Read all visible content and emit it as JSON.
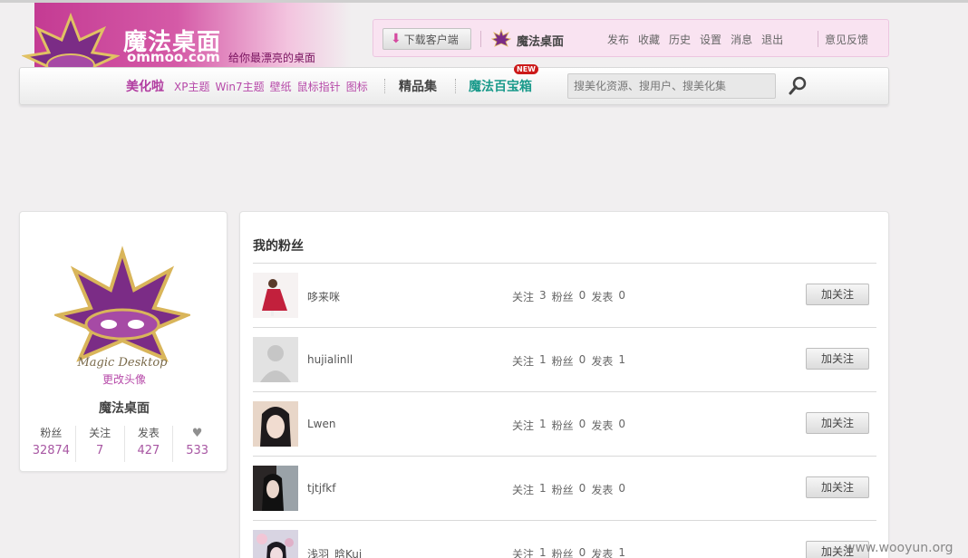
{
  "header": {
    "site_name": "魔法桌面",
    "site_domain": "ommoo.com",
    "slogan": "给你最漂亮的桌面",
    "download_label": "下载客户端",
    "app_name": "魔法桌面",
    "top_links": [
      "发布",
      "收藏",
      "历史",
      "设置",
      "消息",
      "退出"
    ],
    "feedback": "意见反馈"
  },
  "nav": {
    "main": "美化啦",
    "links": [
      "XP主题",
      "Win7主题",
      "壁纸",
      "鼠标指针",
      "图标"
    ],
    "featured": "精品集",
    "treasure": "魔法百宝箱",
    "new_badge": "NEW",
    "search_placeholder": "搜美化资源、搜用户、搜美化集"
  },
  "profile": {
    "change_avatar": "更改头像",
    "name": "魔法桌面",
    "stats": [
      {
        "label": "粉丝",
        "value": "32874"
      },
      {
        "label": "关注",
        "value": "7"
      },
      {
        "label": "发表",
        "value": "427"
      },
      {
        "label": "",
        "icon": "heart-icon",
        "value": "533"
      }
    ]
  },
  "fans": {
    "title": "我的粉丝",
    "follow_label": "加关注",
    "stat_labels": {
      "following": "关注",
      "fans": "粉丝",
      "posts": "发表"
    },
    "items": [
      {
        "name": "哆来咪",
        "following": "3",
        "fans": "0",
        "posts": "0",
        "avatar": "red-dress"
      },
      {
        "name": "hujialinll",
        "following": "1",
        "fans": "0",
        "posts": "1",
        "avatar": "default"
      },
      {
        "name": "Lwen",
        "following": "1",
        "fans": "0",
        "posts": "0",
        "avatar": "girl-dark"
      },
      {
        "name": "tjtjfkf",
        "following": "1",
        "fans": "0",
        "posts": "0",
        "avatar": "girl-window"
      },
      {
        "name": "浅羽_晗Kui",
        "following": "1",
        "fans": "0",
        "posts": "1",
        "avatar": "girl-flowers"
      }
    ]
  },
  "watermark": "www.wooyun.org",
  "colors": {
    "accent": "#b74aa9",
    "teal": "#1a9a8b",
    "banner": "#c43b93"
  }
}
